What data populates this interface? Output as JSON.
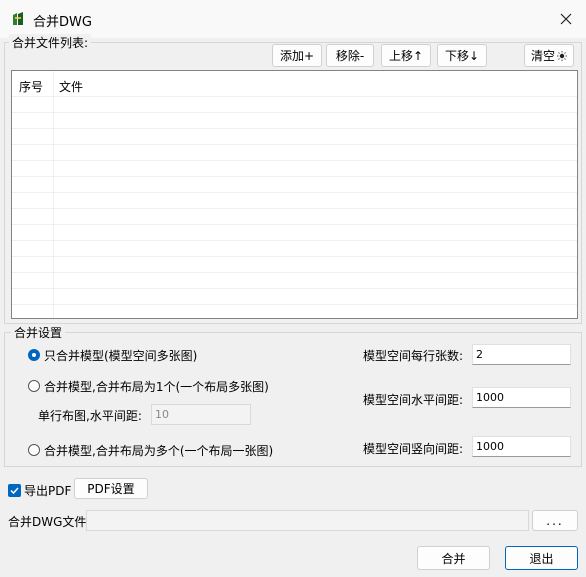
{
  "window": {
    "title": "合并DWG"
  },
  "file_list": {
    "section_label": "合并文件列表:",
    "toolbar": {
      "add": "添加+",
      "remove": "移除-",
      "move_up": "上移↑",
      "move_down": "下移↓",
      "clear": "清空"
    },
    "columns": [
      "序号",
      "文件"
    ],
    "rows": []
  },
  "merge_settings": {
    "section_label": "合并设置",
    "options": [
      {
        "label": "只合并模型(模型空间多张图)",
        "selected": true
      },
      {
        "label": "合并模型,合并布局为1个(一个布局多张图)",
        "selected": false
      },
      {
        "label": "合并模型,合并布局为多个(一个布局一张图)",
        "selected": false
      }
    ],
    "single_row_spacing": {
      "label": "单行布图,水平间距:",
      "value": "10"
    },
    "sheets_per_row": {
      "label": "模型空间每行张数:",
      "value": "2"
    },
    "horizontal_spacing": {
      "label": "模型空间水平间距:",
      "value": "1000"
    },
    "vertical_spacing": {
      "label": "模型空间竖向间距:",
      "value": "1000"
    }
  },
  "export_pdf": {
    "label": "导出PDF",
    "checked": true,
    "settings_button": "PDF设置"
  },
  "output": {
    "label": "合并DWG文件",
    "path": "",
    "browse": "..."
  },
  "footer": {
    "merge": "合并",
    "exit": "退出"
  },
  "colors": {
    "accent": "#0067c0",
    "background": "#f0f0f0"
  }
}
